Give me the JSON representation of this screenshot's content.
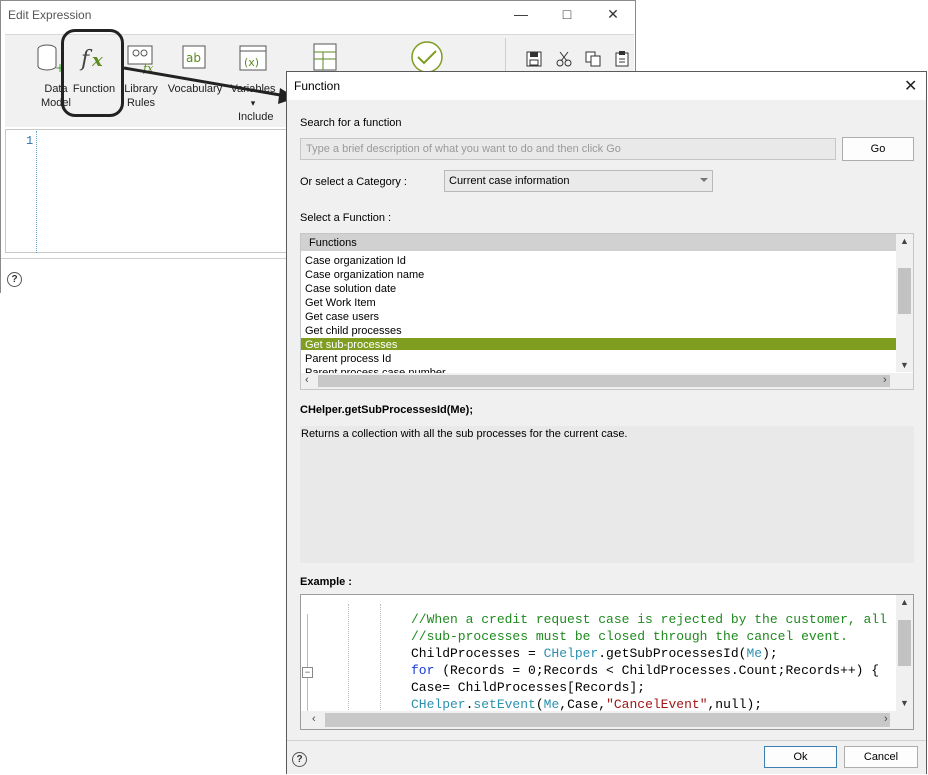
{
  "edit_window": {
    "title": "Edit Expression",
    "tools": [
      {
        "name": "data-model-tool",
        "line1": "Data",
        "line2": "Model"
      },
      {
        "name": "function-tool",
        "line1": "Function",
        "line2": ""
      },
      {
        "name": "library-rules-tool",
        "line1": "Library",
        "line2": "Rules"
      },
      {
        "name": "vocabulary-tool",
        "line1": "Vocabulary",
        "line2": ""
      },
      {
        "name": "variables-tool",
        "line1": "Variables",
        "line2": "▾"
      }
    ],
    "include_label": "Include",
    "line_number": "1"
  },
  "function_dialog": {
    "title": "Function",
    "search_label": "Search for a function",
    "search_placeholder": "Type a brief description of what you want to do and then click Go",
    "go_label": "Go",
    "category_label": "Or select a Category :",
    "category_value": "Current case information",
    "select_label": "Select a Function :",
    "list_header": "Functions",
    "functions": [
      "Case organization Id",
      "Case organization name",
      "Case solution date",
      "Get Work Item",
      "Get case users",
      "Get child processes",
      "Get sub-processes",
      "Parent process Id",
      "Parent process case number"
    ],
    "selected_function": "Get sub-processes",
    "signature": "CHelper.getSubProcessesId(Me);",
    "description": "Returns a collection with all the sub processes for the current case.",
    "example_label": "Example :",
    "code_lines": [
      "//When a credit request case is rejected by the customer, all",
      "//sub-processes must be closed through the cancel event.",
      "ChildProcesses = CHelper.getSubProcessesId(Me);",
      "for (Records = 0;Records < ChildProcesses.Count;Records++) {",
      "Case= ChildProcesses[Records];",
      "CHelper.setEvent(Me,Case,\"CancelEvent\",null);"
    ],
    "ok_label": "Ok",
    "cancel_label": "Cancel"
  },
  "colors": {
    "selection": "#7f9d1f",
    "comment": "#1f8a1f",
    "keyword": "#1a3bd6"
  }
}
